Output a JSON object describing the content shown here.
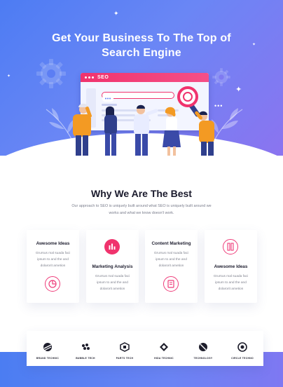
{
  "hero": {
    "title_line1": "Get Your Business To The Top of",
    "title_line2": "Search Engine",
    "browser_label": "SEO"
  },
  "why": {
    "title": "Why We Are The Best",
    "desc_line1": "Our approach to SEO is uniquely built around what  SEO is uniquely built around  we",
    "desc_line2": "works and what we know doesn't work."
  },
  "cards": [
    {
      "title": "Awesome Ideas",
      "line1": "Grursus mal suada faci",
      "line2": "ipsum to and the and",
      "line3": "dolarorit ametion",
      "icon": "pie-chart-icon"
    },
    {
      "title": "Marketing Analysis",
      "line1": "Grursus mal suada faci",
      "line2": "ipsum to and the and",
      "line3": "dolarorit ametion",
      "icon": "bar-chart-icon"
    },
    {
      "title": "Content Marketing",
      "line1": "Grursus mal suada faci",
      "line2": "ipsum to and the and",
      "line3": "dolarorit ametion",
      "icon": "document-icon"
    },
    {
      "title": "Awesome Ideas",
      "line1": "Grursus mal suada faci",
      "line2": "ipsum to and the and",
      "line3": "dolarorit ametion",
      "icon": "pencil-ruler-icon"
    }
  ],
  "brands": [
    {
      "name": "BRAND TECHNIC",
      "icon": "brand-technic-logo-icon"
    },
    {
      "name": "BUBBLE TECH",
      "icon": "bubble-tech-logo-icon"
    },
    {
      "name": "PARTS TECH",
      "icon": "parts-tech-logo-icon"
    },
    {
      "name": "HIDA TECHNIC",
      "icon": "hida-technic-logo-icon"
    },
    {
      "name": "TECHNOLOGY",
      "icon": "technology-logo-icon"
    },
    {
      "name": "CIRCLE TECHNO",
      "icon": "circle-techno-logo-icon"
    }
  ],
  "colors": {
    "hero_start": "#4d7cf3",
    "hero_end": "#8b74f0",
    "accent_pink": "#f0336d",
    "people_orange": "#f39a23",
    "people_navy": "#2f3f8c"
  }
}
